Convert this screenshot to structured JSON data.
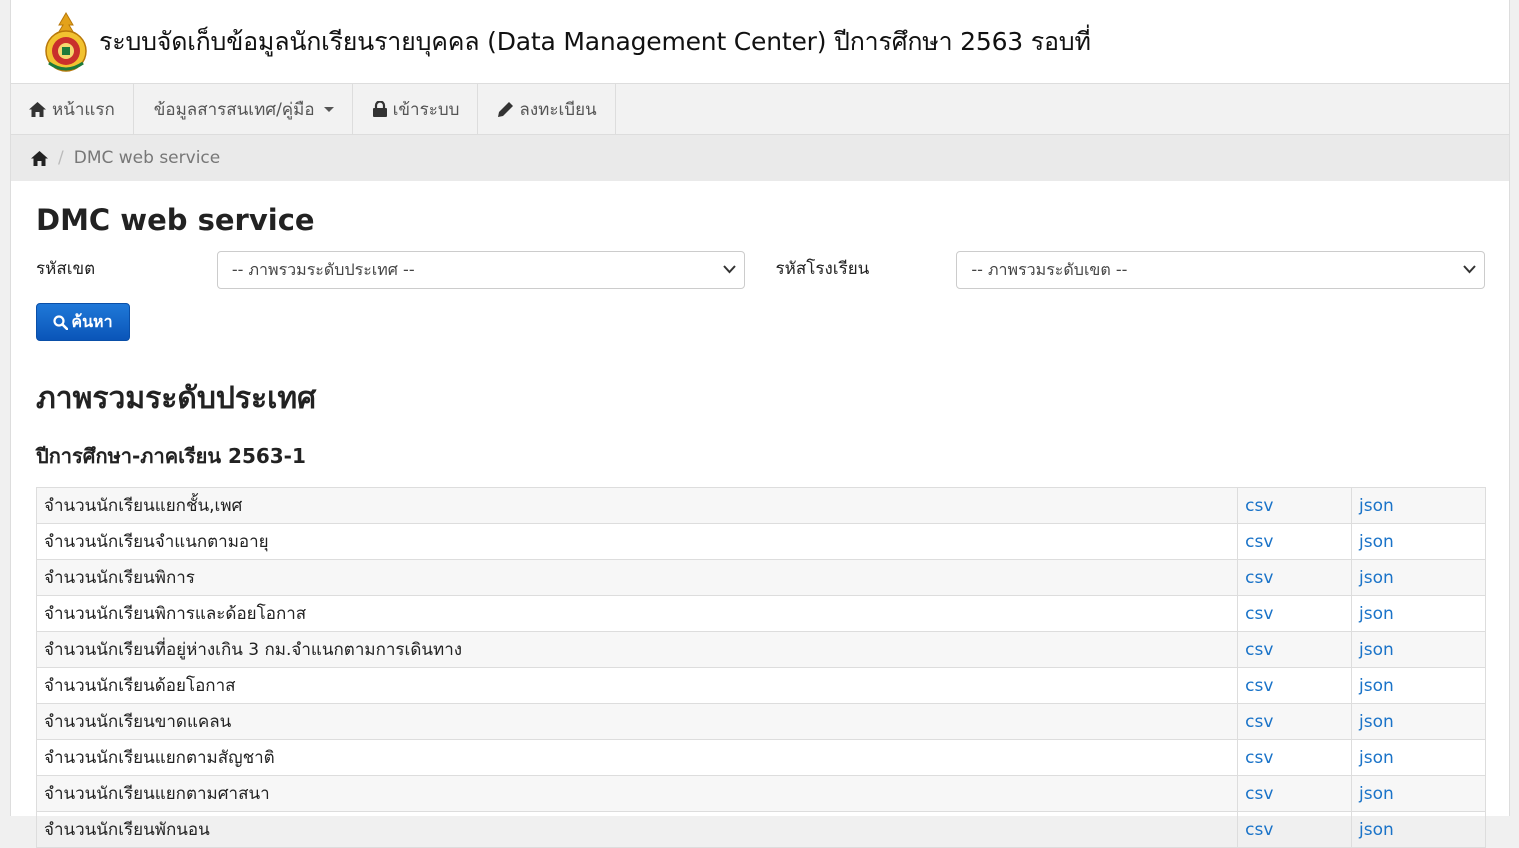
{
  "header": {
    "title": "ระบบจัดเก็บข้อมูลนักเรียนรายบุคคล (Data Management Center) ปีการศึกษา 2563 รอบที่"
  },
  "nav": {
    "items": [
      {
        "label": "หน้าแรก",
        "icon": "home-icon"
      },
      {
        "label": "ข้อมูลสารสนเทศ/คู่มือ",
        "icon": "chevron-down-icon"
      },
      {
        "label": "เข้าระบบ",
        "icon": "lock-icon"
      },
      {
        "label": "ลงทะเบียน",
        "icon": "pencil-icon"
      }
    ]
  },
  "breadcrumb": {
    "current": "DMC web service"
  },
  "page": {
    "title": "DMC web service"
  },
  "filters": {
    "district_label": "รหัสเขต",
    "district_value": "-- ภาพรวมระดับประเทศ --",
    "school_label": "รหัสโรงเรียน",
    "school_value": "-- ภาพรวมระดับเขต --",
    "search_label": "ค้นหา"
  },
  "section": {
    "title": "ภาพรวมระดับประเทศ",
    "subtitle": "ปีการศึกษา-ภาคเรียน 2563-1"
  },
  "table": {
    "rows": [
      {
        "name": "จำนวนนักเรียนแยกชั้น,เพศ",
        "csv": "csv",
        "json": "json"
      },
      {
        "name": "จำนวนนักเรียนจำแนกตามอายุ",
        "csv": "csv",
        "json": "json"
      },
      {
        "name": "จำนวนนักเรียนพิการ",
        "csv": "csv",
        "json": "json"
      },
      {
        "name": "จำนวนนักเรียนพิการและด้อยโอกาส",
        "csv": "csv",
        "json": "json"
      },
      {
        "name": "จำนวนนักเรียนที่อยู่ห่างเกิน 3 กม.จำแนกตามการเดินทาง",
        "csv": "csv",
        "json": "json"
      },
      {
        "name": "จำนวนนักเรียนด้อยโอกาส",
        "csv": "csv",
        "json": "json"
      },
      {
        "name": "จำนวนนักเรียนขาดแคลน",
        "csv": "csv",
        "json": "json"
      },
      {
        "name": "จำนวนนักเรียนแยกตามสัญชาติ",
        "csv": "csv",
        "json": "json"
      },
      {
        "name": "จำนวนนักเรียนแยกตามศาสนา",
        "csv": "csv",
        "json": "json"
      },
      {
        "name": "จำนวนนักเรียนพักนอน",
        "csv": "csv",
        "json": "json"
      }
    ]
  },
  "colors": {
    "link": "#1a73c8",
    "button": "#0a55b8"
  }
}
